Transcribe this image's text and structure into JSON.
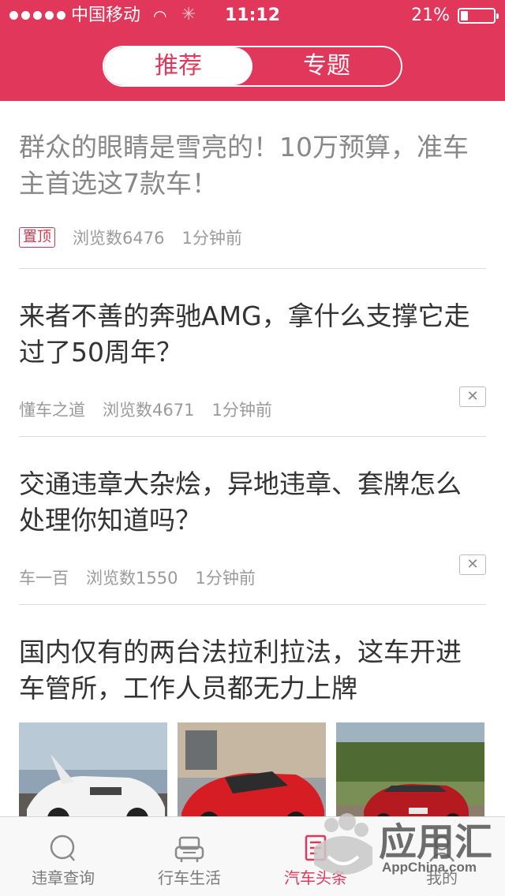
{
  "status_bar": {
    "carrier": "中国移动",
    "time": "11:12",
    "battery": "21%",
    "battery_level": 0.21,
    "signal_bars": 5
  },
  "segment": {
    "tabs": [
      {
        "label": "推荐",
        "active": true
      },
      {
        "label": "专题",
        "active": false
      }
    ]
  },
  "articles": [
    {
      "title": "群众的眼睛是雪亮的！10万预算，准车主首选这7款车！",
      "badge": "置顶",
      "views": "浏览数6476",
      "time": "1分钟前",
      "read": true
    },
    {
      "title": "来者不善的奔驰AMG，拿什么支撑它走过了50周年？",
      "source": "懂车之道",
      "views": "浏览数4671",
      "time": "1分钟前",
      "close": "✕"
    },
    {
      "title": "交通违章大杂烩，异地违章、套牌怎么处理你知道吗？",
      "source": "车一百",
      "views": "浏览数1550",
      "time": "1分钟前",
      "close": "✕"
    },
    {
      "title": "国内仅有的两台法拉利拉法，这车开进车管所，工作人员都无力上牌"
    }
  ],
  "tabbar": {
    "tabs": [
      {
        "label": "违章查询",
        "icon": "search-icon"
      },
      {
        "label": "行车生活",
        "icon": "car-icon"
      },
      {
        "label": "汽车头条",
        "icon": "news-icon",
        "active": true
      },
      {
        "label": "我的",
        "icon": "user-icon"
      }
    ]
  },
  "watermark": {
    "main": "应用汇",
    "sub": "AppChina.com"
  },
  "colors": {
    "accent": "#e0375a",
    "header_bg": "#e0375a",
    "text": "#333333",
    "muted": "#9a9a9a"
  }
}
